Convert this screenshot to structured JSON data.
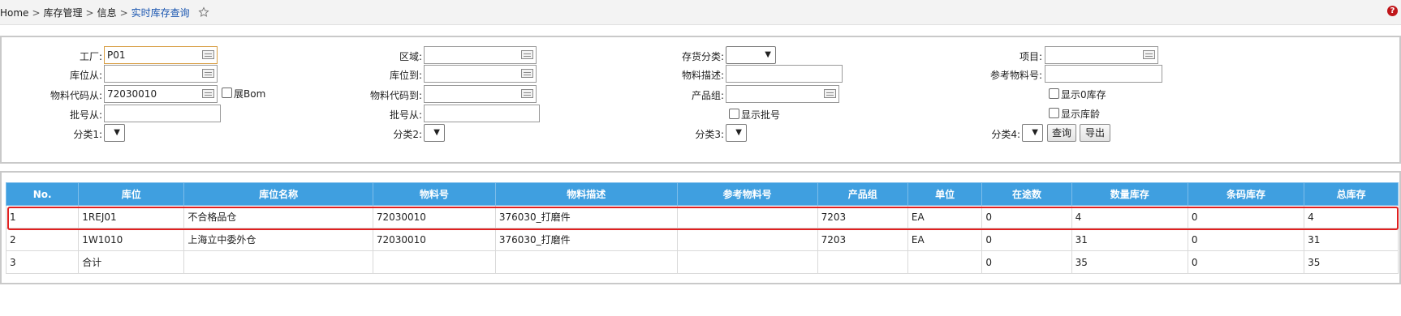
{
  "breadcrumb": {
    "home": "Home",
    "sep": ">",
    "level1": "库存管理",
    "level2": "信息",
    "current": "实时库存查询"
  },
  "help_icon_text": "?",
  "filters": {
    "plant_label": "工厂:",
    "plant_value": "P01",
    "area_label": "区域:",
    "stock_category_label": "存货分类:",
    "project_label": "项目:",
    "location_from_label": "库位从:",
    "location_to_label": "库位到:",
    "material_desc_label": "物料描述:",
    "ref_material_label": "参考物料号:",
    "material_from_label": "物料代码从:",
    "material_from_value": "72030010",
    "expand_bom_label": "展Bom",
    "material_to_label": "物料代码到:",
    "product_group_label": "产品组:",
    "show_zero_label": "显示0库存",
    "batch_from_label": "批号从:",
    "batch_from2_label": "批号从:",
    "show_batch_label": "显示批号",
    "show_age_label": "显示库龄",
    "cat1_label": "分类1:",
    "cat2_label": "分类2:",
    "cat3_label": "分类3:",
    "cat4_label": "分类4:",
    "query_button": "查询",
    "export_button": "导出"
  },
  "table": {
    "headers": [
      "No.",
      "库位",
      "库位名称",
      "物料号",
      "物料描述",
      "参考物料号",
      "产品组",
      "单位",
      "在途数",
      "数量库存",
      "条码库存",
      "总库存"
    ],
    "rows": [
      [
        "1",
        "1REJ01",
        "不合格品仓",
        "72030010",
        "376030_打磨件",
        "",
        "7203",
        "EA",
        "0",
        "4",
        "0",
        "4"
      ],
      [
        "2",
        "1W1010",
        "上海立中委外仓",
        "72030010",
        "376030_打磨件",
        "",
        "7203",
        "EA",
        "0",
        "31",
        "0",
        "31"
      ],
      [
        "3",
        "合计",
        "",
        "",
        "",
        "",
        "",
        "",
        "0",
        "35",
        "0",
        "35"
      ]
    ]
  },
  "colors": {
    "header_bg": "#3f9fe0",
    "highlight_border": "#e02020",
    "current_crumb": "#1a56b0"
  }
}
